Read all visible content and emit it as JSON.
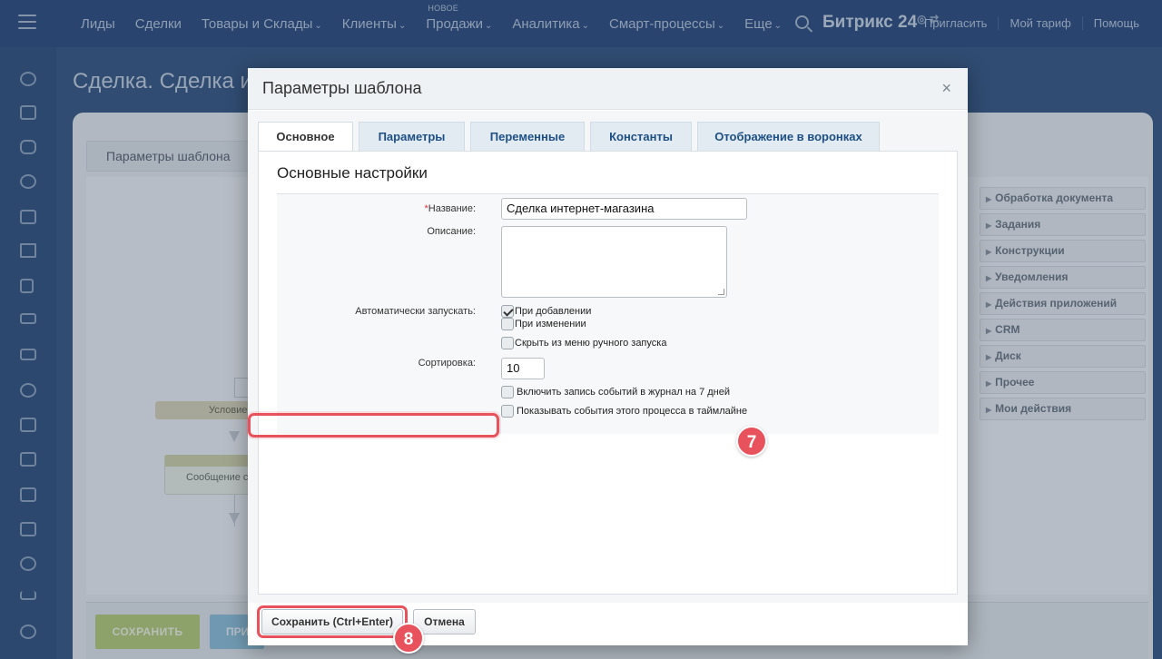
{
  "topbar": {
    "nav": [
      {
        "label": "Лиды",
        "chevron": false,
        "badge": ""
      },
      {
        "label": "Сделки",
        "chevron": false,
        "badge": ""
      },
      {
        "label": "Товары и Склады",
        "chevron": true,
        "badge": ""
      },
      {
        "label": "Клиенты",
        "chevron": true,
        "badge": ""
      },
      {
        "label": "Продажи",
        "chevron": true,
        "badge": "НОВОЕ"
      },
      {
        "label": "Аналитика",
        "chevron": true,
        "badge": ""
      },
      {
        "label": "Смарт-процессы",
        "chevron": true,
        "badge": ""
      },
      {
        "label": "Еще",
        "chevron": true,
        "badge": ""
      }
    ],
    "brand": "Битрикс 24",
    "invite": "Пригласить",
    "tariff": "Мой тариф",
    "help": "Помощь"
  },
  "background": {
    "page_title": "Сделка. Сделка ин",
    "tab_label": "Параметры шаблона",
    "node_condition": "Условие",
    "node_message": "Сообщение с",
    "side_panel": [
      "Обработка документа",
      "Задания",
      "Конструкции",
      "Уведомления",
      "Действия приложений",
      "CRM",
      "Диск",
      "Прочее",
      "Мои действия"
    ],
    "save_button": "СОХРАНИТЬ",
    "apply_button": "ПРИ"
  },
  "dialog": {
    "title": "Параметры шаблона",
    "close_glyph": "×",
    "tabs": [
      "Основное",
      "Параметры",
      "Переменные",
      "Константы",
      "Отображение в воронках"
    ],
    "section_title": "Основные настройки",
    "fields": {
      "name_required_mark": "*",
      "name_label": "Название:",
      "name_value": "Сделка интернет-магазина",
      "description_label": "Описание:",
      "autostart_label": "Автоматически запускать:",
      "on_add": "При добавлении",
      "on_add_checked": true,
      "on_change": "При изменении",
      "on_change_checked": false,
      "hide_manual": "Скрыть из меню ручного запуска",
      "hide_manual_checked": false,
      "sort_label": "Сортировка:",
      "sort_value": "10",
      "log_events": "Включить запись событий в журнал на 7 дней",
      "log_events_checked": false,
      "timeline_events": "Показывать события этого процесса в таймлайне",
      "timeline_events_checked": false
    },
    "save_button": "Сохранить (Ctrl+Enter)",
    "cancel_button": "Отмена"
  },
  "annotations": {
    "step_7": "7",
    "step_8": "8",
    "color": "#e8525c"
  }
}
